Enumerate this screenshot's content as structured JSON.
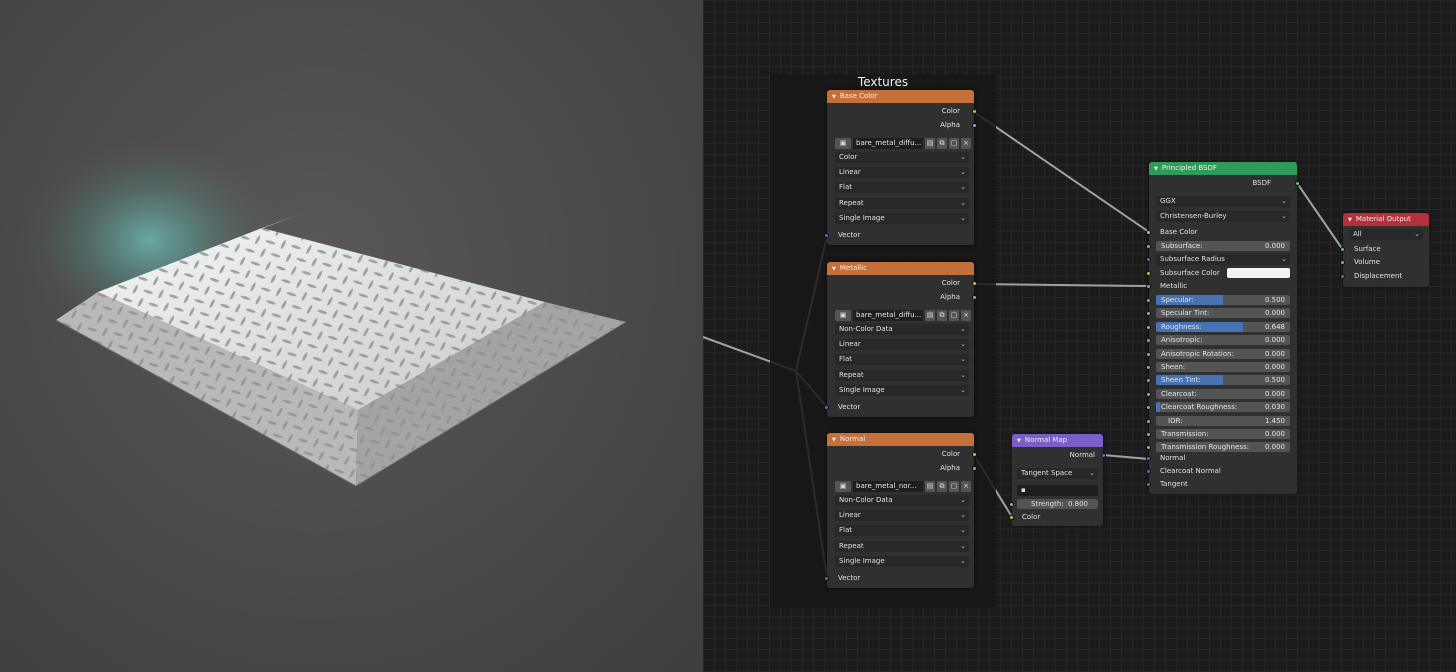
{
  "frame": {
    "title": "Textures"
  },
  "texture_nodes": [
    {
      "title": "Base Color",
      "outputs": [
        "Color",
        "Alpha"
      ],
      "image_name": "bare_metal_diffu...",
      "color_space": "Color",
      "interpolation": "Linear",
      "projection": "Flat",
      "extension": "Repeat",
      "source": "Single Image",
      "input": "Vector"
    },
    {
      "title": "Metallic",
      "outputs": [
        "Color",
        "Alpha"
      ],
      "image_name": "bare_metal_diffu...",
      "color_space": "Non-Color Data",
      "interpolation": "Linear",
      "projection": "Flat",
      "extension": "Repeat",
      "source": "Single Image",
      "input": "Vector"
    },
    {
      "title": "Normal",
      "outputs": [
        "Color",
        "Alpha"
      ],
      "image_name": "bare_metal_nor...",
      "color_space": "Non-Color Data",
      "interpolation": "Linear",
      "projection": "Flat",
      "extension": "Repeat",
      "source": "Single Image",
      "input": "Vector"
    }
  ],
  "normal_map": {
    "title": "Normal Map",
    "output": "Normal",
    "space": "Tangent Space",
    "uv_field": "",
    "strength_label": "Strength:",
    "strength_value": "0.800",
    "input": "Color"
  },
  "principled": {
    "title": "Principled BSDF",
    "output": "BSDF",
    "distribution": "GGX",
    "subsurface_method": "Christensen-Burley",
    "base_color_label": "Base Color",
    "subsurface": {
      "label": "Subsurface:",
      "value": "0.000"
    },
    "subsurface_radius": "Subsurface Radius",
    "subsurface_color_label": "Subsurface Color",
    "metallic_label": "Metallic",
    "params": [
      {
        "label": "Specular:",
        "value": "0.500",
        "fill": 0.5
      },
      {
        "label": "Specular Tint:",
        "value": "0.000",
        "fill": 0
      },
      {
        "label": "Roughness:",
        "value": "0.648",
        "fill": 0.648
      },
      {
        "label": "Anisotropic:",
        "value": "0.000",
        "fill": 0
      },
      {
        "label": "Anisotropic Rotation:",
        "value": "0.000",
        "fill": 0
      },
      {
        "label": "Sheen:",
        "value": "0.000",
        "fill": 0
      },
      {
        "label": "Sheen Tint:",
        "value": "0.500",
        "fill": 0.5
      },
      {
        "label": "Clearcoat:",
        "value": "0.000",
        "fill": 0
      },
      {
        "label": "Clearcoat Roughness:",
        "value": "0.030",
        "fill": 0.03
      },
      {
        "label": "IOR:",
        "value": "1.450",
        "fill": 0
      },
      {
        "label": "Transmission:",
        "value": "0.000",
        "fill": 0
      },
      {
        "label": "Transmission Roughness:",
        "value": "0.000",
        "fill": 0
      }
    ],
    "normal_label": "Normal",
    "clearcoat_normal_label": "Clearcoat Normal",
    "tangent_label": "Tangent"
  },
  "material_output": {
    "title": "Material Output",
    "target": "All",
    "inputs": [
      "Surface",
      "Volume",
      "Displacement"
    ]
  },
  "colors": {
    "texture_header": "#c4703a",
    "shader_header": "#2f9b5a",
    "vector_header": "#7a5fc8",
    "output_header": "#b3313b",
    "slider_fill": "#4772b3"
  }
}
